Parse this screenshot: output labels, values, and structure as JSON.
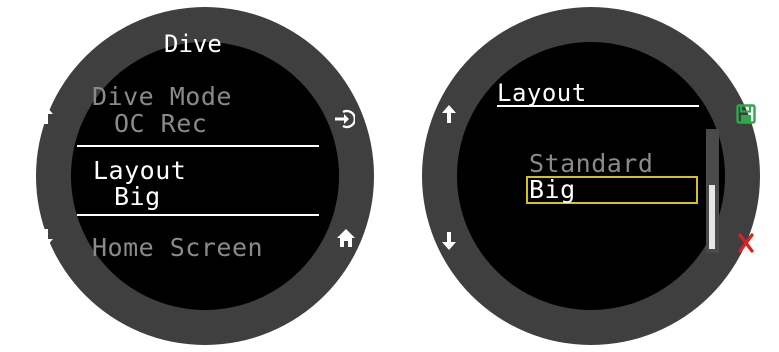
{
  "left_screen": {
    "title": "Dive",
    "items": [
      {
        "label": "Dive Mode",
        "value": "OC Rec"
      },
      {
        "label": "Layout",
        "value": "Big"
      },
      {
        "label": "Home Screen"
      }
    ],
    "icons": [
      "arrow-up-icon",
      "arrow-down-icon",
      "enter-icon",
      "home-icon"
    ]
  },
  "right_screen": {
    "title": "Layout",
    "options": [
      "Standard",
      "Big"
    ],
    "selected_option": "Big",
    "icons": [
      "arrow-up-icon",
      "arrow-down-icon",
      "save-icon",
      "cancel-icon"
    ],
    "colors": {
      "save": "#2ea84a",
      "cancel": "#e02020",
      "selection": "#d6c21a"
    }
  }
}
